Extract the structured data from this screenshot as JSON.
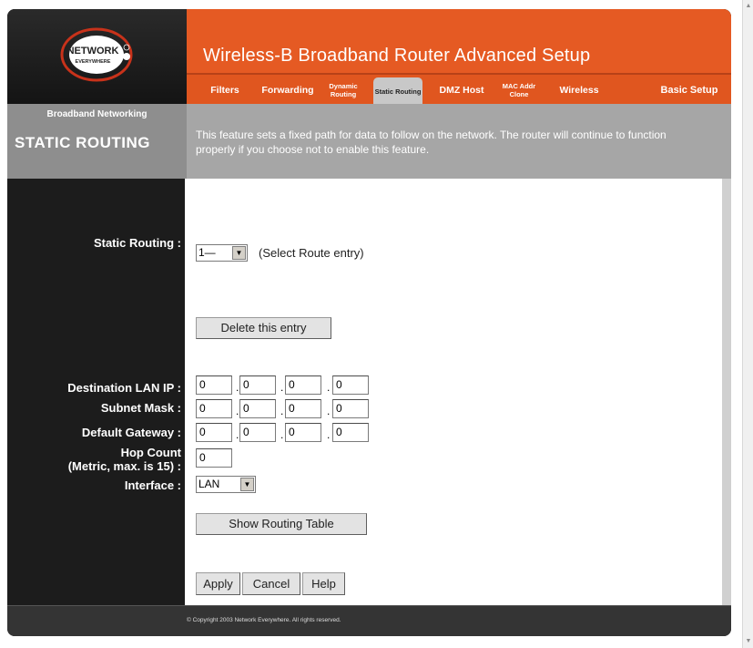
{
  "header": {
    "logo_text_top": "NETWORK",
    "logo_text_bottom": "EVERYWHERE",
    "title": "Wireless-B Broadband  Router Advanced Setup"
  },
  "tabs": [
    {
      "label": "Filters"
    },
    {
      "label": "Forwarding"
    },
    {
      "label": "Dynamic Routing"
    },
    {
      "label": "Static Routing",
      "active": true
    },
    {
      "label": "DMZ Host"
    },
    {
      "label": "MAC Addr Clone"
    },
    {
      "label": "Wireless"
    },
    {
      "label": "Basic Setup"
    }
  ],
  "band": {
    "subtitle": "Broadband Networking",
    "section_title": "STATIC ROUTING",
    "description": "This feature sets a fixed path for data to follow on the network. The router will continue to function properly if you choose not to enable this feature."
  },
  "form": {
    "static_routing_label": "Static Routing :",
    "route_select_value": "1—",
    "route_select_hint": "(Select Route entry)",
    "delete_button": "Delete this entry",
    "dest_ip_label": "Destination LAN IP :",
    "subnet_label": "Subnet Mask :",
    "gateway_label": "Default Gateway :",
    "hop_label_1": "Hop Count",
    "hop_label_2": "(Metric, max. is 15) :",
    "interface_label": "Interface :",
    "dest_ip": [
      "0",
      "0",
      "0",
      "0"
    ],
    "subnet": [
      "0",
      "0",
      "0",
      "0"
    ],
    "gateway": [
      "0",
      "0",
      "0",
      "0"
    ],
    "hop_count": "0",
    "interface_value": "LAN",
    "show_table_button": "Show Routing Table",
    "apply_button": "Apply",
    "cancel_button": "Cancel",
    "help_button": "Help",
    "dot": "."
  },
  "footer": {
    "copyright": "© Copyright 2003 Network Everywhere. All rights reserved."
  },
  "colors": {
    "orange": "#e55a23",
    "dark": "#1c1c1c",
    "grey_band": "#a6a6a6"
  }
}
